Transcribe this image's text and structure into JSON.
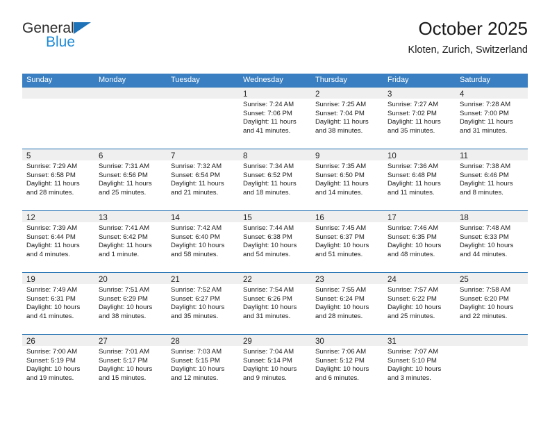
{
  "brand": {
    "name_dark": "General",
    "name_blue": "Blue",
    "triangle_color": "#1e72b8",
    "blue_color": "#1e8ad6"
  },
  "header": {
    "title": "October 2025",
    "subtitle": "Kloten, Zurich, Switzerland"
  },
  "colors": {
    "header_band": "#3a7fc1",
    "row_rule": "#1a6bb0",
    "daynum_band": "#efefef",
    "text": "#1a1a1a"
  },
  "weekdays": [
    "Sunday",
    "Monday",
    "Tuesday",
    "Wednesday",
    "Thursday",
    "Friday",
    "Saturday"
  ],
  "labels": {
    "sunrise_prefix": "Sunrise:",
    "sunset_prefix": "Sunset:",
    "daylight_prefix": "Daylight:"
  },
  "weeks": [
    [
      {
        "day": "",
        "sunrise": "",
        "sunset": "",
        "daylight_line1": "",
        "daylight_line2": ""
      },
      {
        "day": "",
        "sunrise": "",
        "sunset": "",
        "daylight_line1": "",
        "daylight_line2": ""
      },
      {
        "day": "",
        "sunrise": "",
        "sunset": "",
        "daylight_line1": "",
        "daylight_line2": ""
      },
      {
        "day": "1",
        "sunrise": "Sunrise: 7:24 AM",
        "sunset": "Sunset: 7:06 PM",
        "daylight_line1": "Daylight: 11 hours",
        "daylight_line2": "and 41 minutes."
      },
      {
        "day": "2",
        "sunrise": "Sunrise: 7:25 AM",
        "sunset": "Sunset: 7:04 PM",
        "daylight_line1": "Daylight: 11 hours",
        "daylight_line2": "and 38 minutes."
      },
      {
        "day": "3",
        "sunrise": "Sunrise: 7:27 AM",
        "sunset": "Sunset: 7:02 PM",
        "daylight_line1": "Daylight: 11 hours",
        "daylight_line2": "and 35 minutes."
      },
      {
        "day": "4",
        "sunrise": "Sunrise: 7:28 AM",
        "sunset": "Sunset: 7:00 PM",
        "daylight_line1": "Daylight: 11 hours",
        "daylight_line2": "and 31 minutes."
      }
    ],
    [
      {
        "day": "5",
        "sunrise": "Sunrise: 7:29 AM",
        "sunset": "Sunset: 6:58 PM",
        "daylight_line1": "Daylight: 11 hours",
        "daylight_line2": "and 28 minutes."
      },
      {
        "day": "6",
        "sunrise": "Sunrise: 7:31 AM",
        "sunset": "Sunset: 6:56 PM",
        "daylight_line1": "Daylight: 11 hours",
        "daylight_line2": "and 25 minutes."
      },
      {
        "day": "7",
        "sunrise": "Sunrise: 7:32 AM",
        "sunset": "Sunset: 6:54 PM",
        "daylight_line1": "Daylight: 11 hours",
        "daylight_line2": "and 21 minutes."
      },
      {
        "day": "8",
        "sunrise": "Sunrise: 7:34 AM",
        "sunset": "Sunset: 6:52 PM",
        "daylight_line1": "Daylight: 11 hours",
        "daylight_line2": "and 18 minutes."
      },
      {
        "day": "9",
        "sunrise": "Sunrise: 7:35 AM",
        "sunset": "Sunset: 6:50 PM",
        "daylight_line1": "Daylight: 11 hours",
        "daylight_line2": "and 14 minutes."
      },
      {
        "day": "10",
        "sunrise": "Sunrise: 7:36 AM",
        "sunset": "Sunset: 6:48 PM",
        "daylight_line1": "Daylight: 11 hours",
        "daylight_line2": "and 11 minutes."
      },
      {
        "day": "11",
        "sunrise": "Sunrise: 7:38 AM",
        "sunset": "Sunset: 6:46 PM",
        "daylight_line1": "Daylight: 11 hours",
        "daylight_line2": "and 8 minutes."
      }
    ],
    [
      {
        "day": "12",
        "sunrise": "Sunrise: 7:39 AM",
        "sunset": "Sunset: 6:44 PM",
        "daylight_line1": "Daylight: 11 hours",
        "daylight_line2": "and 4 minutes."
      },
      {
        "day": "13",
        "sunrise": "Sunrise: 7:41 AM",
        "sunset": "Sunset: 6:42 PM",
        "daylight_line1": "Daylight: 11 hours",
        "daylight_line2": "and 1 minute."
      },
      {
        "day": "14",
        "sunrise": "Sunrise: 7:42 AM",
        "sunset": "Sunset: 6:40 PM",
        "daylight_line1": "Daylight: 10 hours",
        "daylight_line2": "and 58 minutes."
      },
      {
        "day": "15",
        "sunrise": "Sunrise: 7:44 AM",
        "sunset": "Sunset: 6:38 PM",
        "daylight_line1": "Daylight: 10 hours",
        "daylight_line2": "and 54 minutes."
      },
      {
        "day": "16",
        "sunrise": "Sunrise: 7:45 AM",
        "sunset": "Sunset: 6:37 PM",
        "daylight_line1": "Daylight: 10 hours",
        "daylight_line2": "and 51 minutes."
      },
      {
        "day": "17",
        "sunrise": "Sunrise: 7:46 AM",
        "sunset": "Sunset: 6:35 PM",
        "daylight_line1": "Daylight: 10 hours",
        "daylight_line2": "and 48 minutes."
      },
      {
        "day": "18",
        "sunrise": "Sunrise: 7:48 AM",
        "sunset": "Sunset: 6:33 PM",
        "daylight_line1": "Daylight: 10 hours",
        "daylight_line2": "and 44 minutes."
      }
    ],
    [
      {
        "day": "19",
        "sunrise": "Sunrise: 7:49 AM",
        "sunset": "Sunset: 6:31 PM",
        "daylight_line1": "Daylight: 10 hours",
        "daylight_line2": "and 41 minutes."
      },
      {
        "day": "20",
        "sunrise": "Sunrise: 7:51 AM",
        "sunset": "Sunset: 6:29 PM",
        "daylight_line1": "Daylight: 10 hours",
        "daylight_line2": "and 38 minutes."
      },
      {
        "day": "21",
        "sunrise": "Sunrise: 7:52 AM",
        "sunset": "Sunset: 6:27 PM",
        "daylight_line1": "Daylight: 10 hours",
        "daylight_line2": "and 35 minutes."
      },
      {
        "day": "22",
        "sunrise": "Sunrise: 7:54 AM",
        "sunset": "Sunset: 6:26 PM",
        "daylight_line1": "Daylight: 10 hours",
        "daylight_line2": "and 31 minutes."
      },
      {
        "day": "23",
        "sunrise": "Sunrise: 7:55 AM",
        "sunset": "Sunset: 6:24 PM",
        "daylight_line1": "Daylight: 10 hours",
        "daylight_line2": "and 28 minutes."
      },
      {
        "day": "24",
        "sunrise": "Sunrise: 7:57 AM",
        "sunset": "Sunset: 6:22 PM",
        "daylight_line1": "Daylight: 10 hours",
        "daylight_line2": "and 25 minutes."
      },
      {
        "day": "25",
        "sunrise": "Sunrise: 7:58 AM",
        "sunset": "Sunset: 6:20 PM",
        "daylight_line1": "Daylight: 10 hours",
        "daylight_line2": "and 22 minutes."
      }
    ],
    [
      {
        "day": "26",
        "sunrise": "Sunrise: 7:00 AM",
        "sunset": "Sunset: 5:19 PM",
        "daylight_line1": "Daylight: 10 hours",
        "daylight_line2": "and 19 minutes."
      },
      {
        "day": "27",
        "sunrise": "Sunrise: 7:01 AM",
        "sunset": "Sunset: 5:17 PM",
        "daylight_line1": "Daylight: 10 hours",
        "daylight_line2": "and 15 minutes."
      },
      {
        "day": "28",
        "sunrise": "Sunrise: 7:03 AM",
        "sunset": "Sunset: 5:15 PM",
        "daylight_line1": "Daylight: 10 hours",
        "daylight_line2": "and 12 minutes."
      },
      {
        "day": "29",
        "sunrise": "Sunrise: 7:04 AM",
        "sunset": "Sunset: 5:14 PM",
        "daylight_line1": "Daylight: 10 hours",
        "daylight_line2": "and 9 minutes."
      },
      {
        "day": "30",
        "sunrise": "Sunrise: 7:06 AM",
        "sunset": "Sunset: 5:12 PM",
        "daylight_line1": "Daylight: 10 hours",
        "daylight_line2": "and 6 minutes."
      },
      {
        "day": "31",
        "sunrise": "Sunrise: 7:07 AM",
        "sunset": "Sunset: 5:10 PM",
        "daylight_line1": "Daylight: 10 hours",
        "daylight_line2": "and 3 minutes."
      },
      {
        "day": "",
        "sunrise": "",
        "sunset": "",
        "daylight_line1": "",
        "daylight_line2": ""
      }
    ]
  ]
}
